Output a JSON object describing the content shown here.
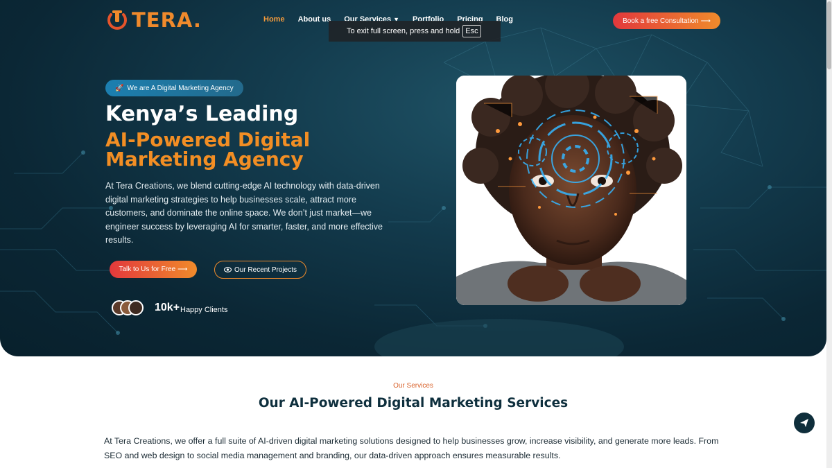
{
  "brand": {
    "name": "TERA.",
    "accent_orange": "#f28e24",
    "accent_red": "#e2383c",
    "navy": "#0e2f3d"
  },
  "nav": {
    "items": [
      {
        "label": "Home",
        "active": true
      },
      {
        "label": "About us",
        "active": false
      },
      {
        "label": "Our Services",
        "active": false,
        "has_dropdown": true
      },
      {
        "label": "Portfolio",
        "active": false
      },
      {
        "label": "Pricing",
        "active": false
      },
      {
        "label": "Blog",
        "active": false
      }
    ],
    "cta_label": "Book a free Consultation",
    "cta_icon": "arrow-right-icon",
    "dropdown_icon": "chevron-down-icon"
  },
  "fullscreen_toast": {
    "text": "To exit full screen, press and hold",
    "key": "Esc"
  },
  "hero": {
    "badge": "We are A Digital Marketing Agency",
    "badge_icon": "rocket-icon",
    "heading_white": "Kenya’s Leading",
    "heading_orange": "AI-Powered Digital Marketing Agency",
    "description": "At Tera Creations, we blend cutting-edge AI technology with data-driven digital marketing strategies to help businesses scale, attract more customers, and dominate the online space. We don’t just market—we engineer success by leveraging AI for smarter, faster, and more effective results.",
    "primary_button": "Talk to Us for Free",
    "secondary_button": "Our Recent Projects",
    "secondary_icon": "eye-icon",
    "clients_count": "10k+",
    "clients_label": "Happy Clients"
  },
  "services": {
    "kicker": "Our Services",
    "title": "Our AI-Powered Digital Marketing Services",
    "description": "At Tera Creations, we offer a full suite of AI-driven digital marketing solutions designed to help businesses grow, increase visibility, and generate more leads. From SEO and web design to social media management and branding, our data-driven approach ensures measurable results."
  },
  "floating_button_icon": "send-icon"
}
